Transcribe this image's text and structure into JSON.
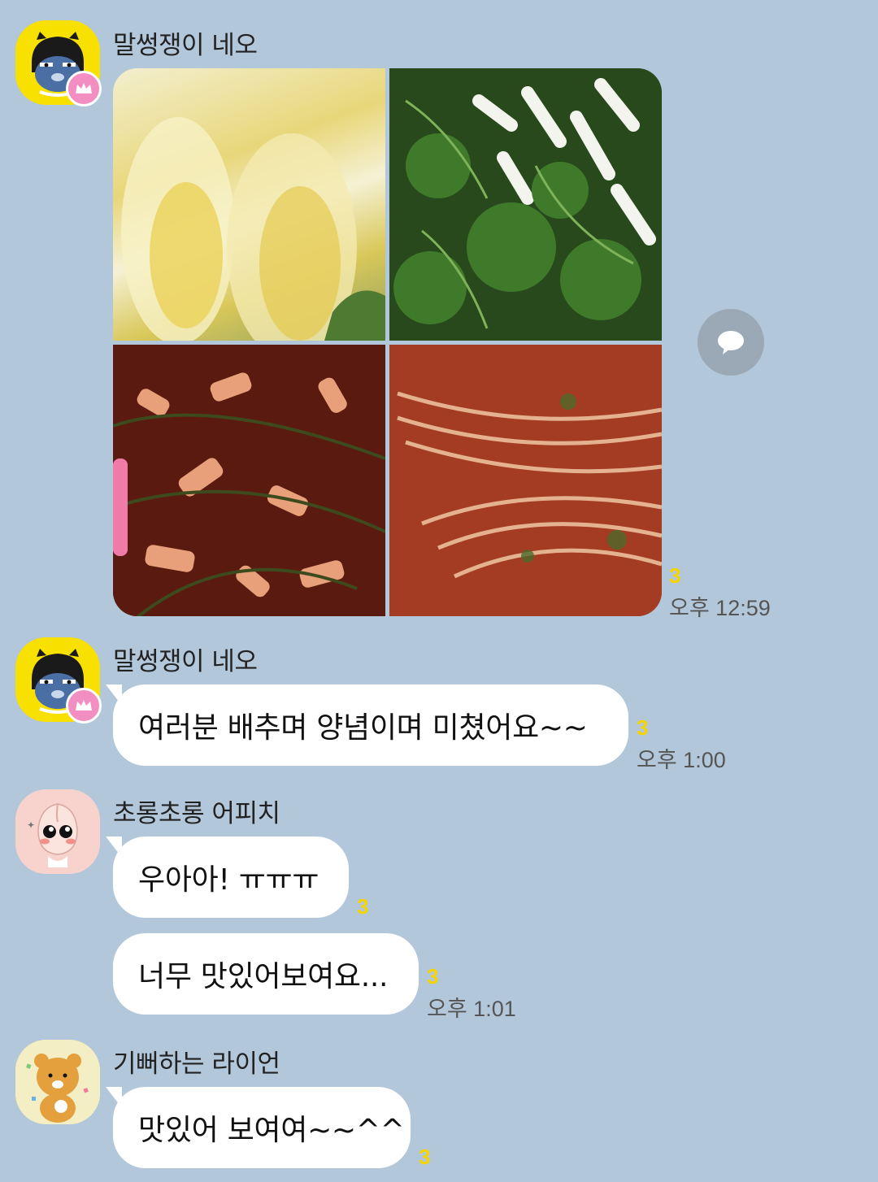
{
  "messages": {
    "m1": {
      "sender": "말썽쟁이 네오",
      "unread": "3",
      "time": "오후 12:59"
    },
    "m2": {
      "sender": "말썽쟁이 네오",
      "text": "여러분 배추며 양념이며 미쳤어요~~",
      "unread": "3",
      "time": "오후 1:00"
    },
    "m3": {
      "sender": "초롱초롱 어피치",
      "text": "우아아! ㅠㅠㅠ",
      "unread": "3"
    },
    "m4": {
      "text": "너무 맛있어보여요...",
      "unread": "3",
      "time": "오후 1:01"
    },
    "m5": {
      "sender": "기뻐하는 라이언",
      "text": "맛있어 보여여~~^^",
      "unread": "3"
    }
  },
  "colors": {
    "background": "#b2c7da",
    "unread": "#f6d400",
    "bubble": "#ffffff"
  },
  "icons": {
    "share": "speech-bubble-icon",
    "crown": "crown-icon"
  }
}
